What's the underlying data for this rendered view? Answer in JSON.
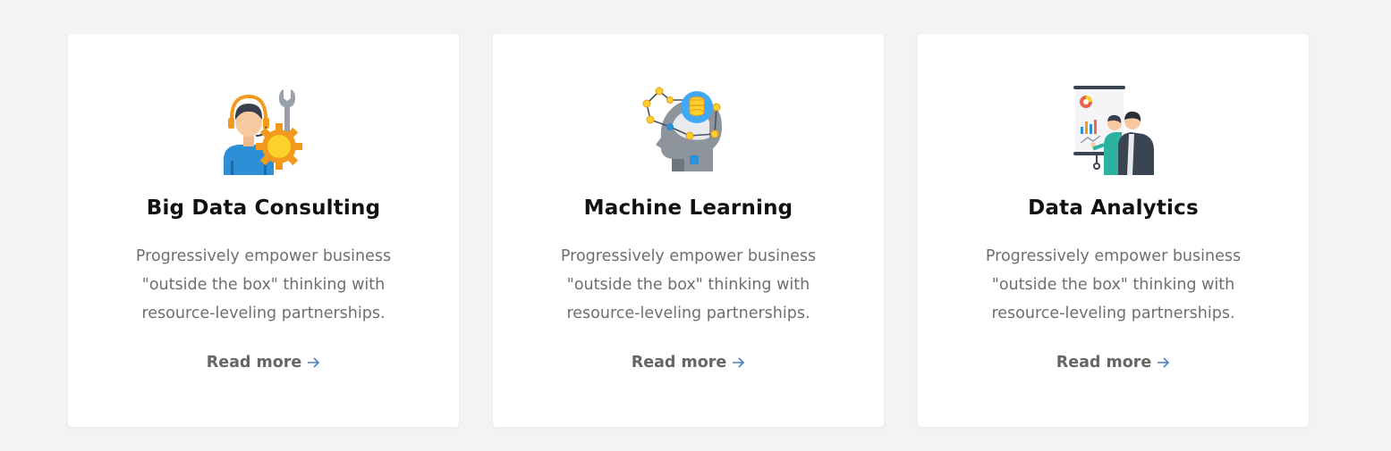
{
  "colors": {
    "background": "#f3f3f3",
    "card": "#ffffff",
    "title": "#111111",
    "text": "#6f6f6f",
    "link": "#666666",
    "arrow": "#4a7fc1"
  },
  "cards": [
    {
      "icon": "consultant-gear-icon",
      "title": "Big Data Consulting",
      "description": "Progressively empower business \"outside the box\" thinking with resource-leveling partnerships.",
      "link_label": "Read more"
    },
    {
      "icon": "ai-head-network-icon",
      "title": "Machine Learning",
      "description": "Progressively empower business \"outside the box\" thinking with resource-leveling partnerships.",
      "link_label": "Read more"
    },
    {
      "icon": "presentation-board-icon",
      "title": "Data Analytics",
      "description": "Progressively empower business \"outside the box\" thinking with resource-leveling partnerships.",
      "link_label": "Read more"
    }
  ]
}
